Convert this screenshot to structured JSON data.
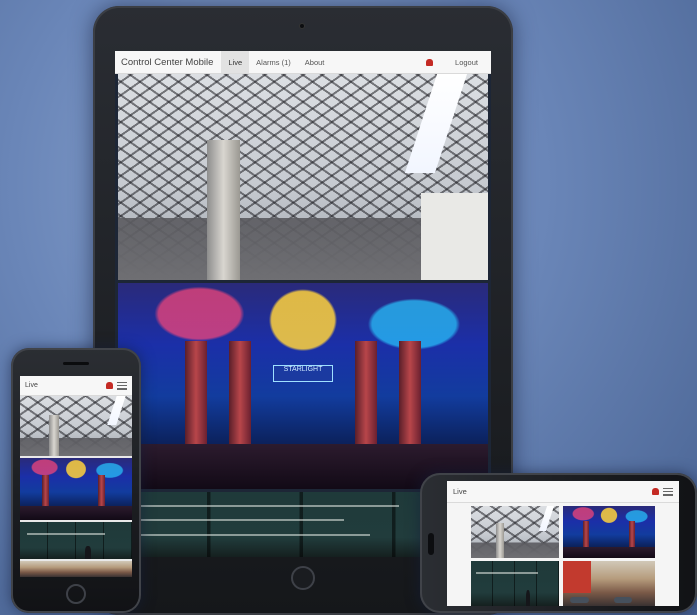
{
  "tablet": {
    "brand": "Control Center Mobile",
    "nav": {
      "live": "Live",
      "alarms": "Alarms (1)",
      "about": "About",
      "logout": "Logout"
    },
    "casino_sign": "STARLIGHT"
  },
  "phone": {
    "nav": {
      "live": "Live"
    }
  },
  "phone_landscape": {
    "nav": {
      "live": "Live"
    }
  },
  "colors": {
    "navbar": "#f7f7f7",
    "active_tab": "#e2e2e2",
    "alarm_bell": "#c42a24"
  }
}
